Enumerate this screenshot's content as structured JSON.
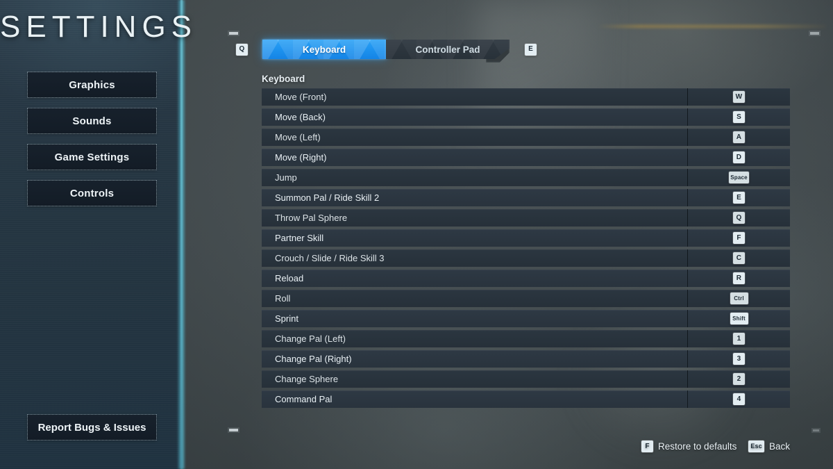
{
  "window": {
    "title": "SETTINGS"
  },
  "sidebar": {
    "title": "SETTINGS",
    "items": [
      {
        "label": "Graphics"
      },
      {
        "label": "Sounds"
      },
      {
        "label": "Game Settings"
      },
      {
        "label": "Controls"
      }
    ],
    "report_button": {
      "label": "Report Bugs & Issues"
    }
  },
  "tabs": {
    "prev_key": "Q",
    "next_key": "E",
    "items": [
      {
        "label": "Keyboard",
        "active": true
      },
      {
        "label": "Controller Pad",
        "active": false
      }
    ]
  },
  "content": {
    "section_label": "Keyboard",
    "bindings": [
      {
        "action": "Move (Front)",
        "key": "W",
        "wide": false
      },
      {
        "action": "Move (Back)",
        "key": "S",
        "wide": false
      },
      {
        "action": "Move (Left)",
        "key": "A",
        "wide": false
      },
      {
        "action": "Move (Right)",
        "key": "D",
        "wide": false
      },
      {
        "action": "Jump",
        "key": "Space",
        "wide": true
      },
      {
        "action": "Summon Pal / Ride Skill 2",
        "key": "E",
        "wide": false
      },
      {
        "action": "Throw Pal Sphere",
        "key": "Q",
        "wide": false
      },
      {
        "action": "Partner Skill",
        "key": "F",
        "wide": false
      },
      {
        "action": "Crouch / Slide / Ride Skill 3",
        "key": "C",
        "wide": false
      },
      {
        "action": "Reload",
        "key": "R",
        "wide": false
      },
      {
        "action": "Roll",
        "key": "Ctrl",
        "wide": true
      },
      {
        "action": "Sprint",
        "key": "Shift",
        "wide": true
      },
      {
        "action": "Change Pal (Left)",
        "key": "1",
        "wide": false
      },
      {
        "action": "Change Pal (Right)",
        "key": "3",
        "wide": false
      },
      {
        "action": "Change Sphere",
        "key": "2",
        "wide": false
      },
      {
        "action": "Command Pal",
        "key": "4",
        "wide": false
      }
    ]
  },
  "footer": {
    "hints": [
      {
        "key": "F",
        "label": "Restore to defaults",
        "wide": false
      },
      {
        "key": "Esc",
        "label": "Back",
        "wide": true
      }
    ]
  },
  "colors": {
    "accent_tab": "#1e93ef",
    "sidebar_edge": "#56b0c2",
    "row_bg": "#2e3944",
    "keycap_bg": "#e3edf2",
    "text": "#eaf1f5"
  }
}
